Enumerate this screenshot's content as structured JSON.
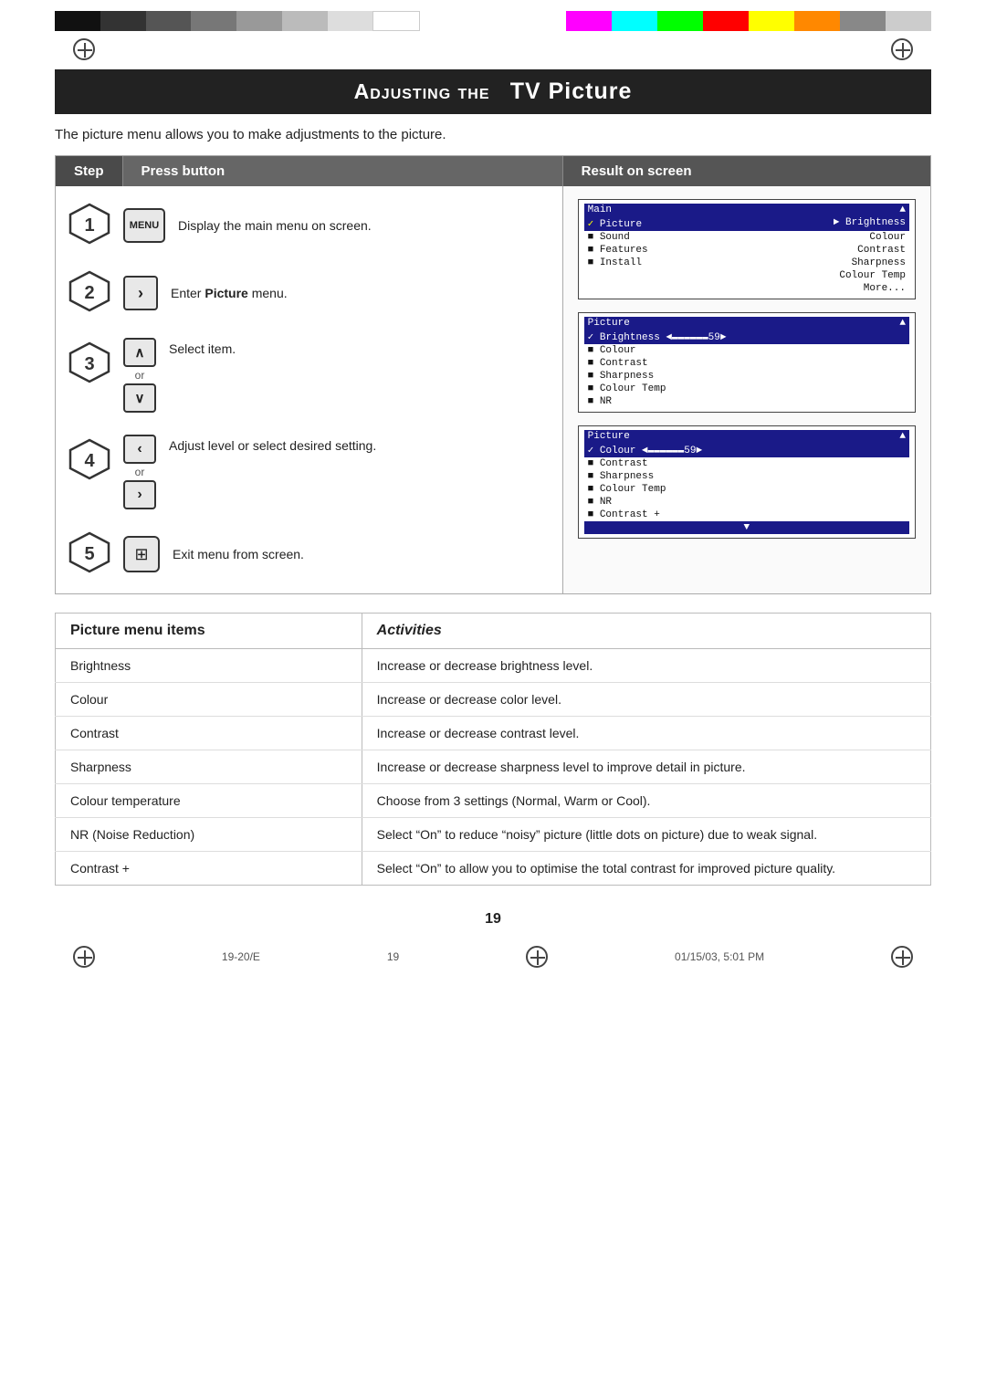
{
  "page": {
    "title": "Adjusting the TV Picture",
    "title_prefix": "Adjusting the",
    "title_main": "TV Picture",
    "intro": "The picture menu allows you to make adjustments to the picture.",
    "page_number": "19",
    "footer_left": "19-20/E",
    "footer_center": "19",
    "footer_right": "01/15/03, 5:01 PM"
  },
  "header": {
    "step_label": "Step",
    "press_label": "Press button",
    "result_label": "Result on screen"
  },
  "steps": [
    {
      "number": "1",
      "button": "MENU",
      "description": "Display the main menu on screen."
    },
    {
      "number": "2",
      "button": ">",
      "description_pre": "Enter ",
      "description_bold": "Picture",
      "description_post": " menu."
    },
    {
      "number": "3",
      "button_up": "∧",
      "button_down": "∨",
      "description": "Select item."
    },
    {
      "number": "4",
      "button_left": "<",
      "button_right": ">",
      "description": "Adjust level or select desired setting."
    },
    {
      "number": "5",
      "button": "⊞",
      "description": "Exit menu from screen."
    }
  ],
  "screens": {
    "screen1": {
      "title": "Main",
      "arrow": "▲",
      "rows": [
        {
          "check": "✓",
          "label": "Picture",
          "right": "► Brightness"
        },
        {
          "bullet": "■",
          "label": "Sound",
          "right": "Colour"
        },
        {
          "bullet": "■",
          "label": "Features",
          "right": "Contrast"
        },
        {
          "bullet": "■",
          "label": "Install",
          "right": "Sharpness"
        },
        {
          "bullet": "",
          "label": "",
          "right": "Colour Temp"
        },
        {
          "bullet": "",
          "label": "",
          "right": "More..."
        }
      ]
    },
    "screen2": {
      "title": "Picture",
      "arrow": "▲",
      "slider_row": "► Brightness ◄▬▬▬▬▬▬▬59►",
      "rows": [
        {
          "bullet": "■",
          "label": "Colour",
          "right": ""
        },
        {
          "bullet": "■",
          "label": "Contrast",
          "right": ""
        },
        {
          "bullet": "■",
          "label": "Sharpness",
          "right": ""
        },
        {
          "bullet": "■",
          "label": "Colour Temp",
          "right": ""
        },
        {
          "bullet": "■",
          "label": "NR",
          "right": ""
        }
      ]
    },
    "screen3": {
      "title": "Picture",
      "arrow": "▲",
      "slider_row": "✓ Colour ◄▬▬▬▬▬▬▬59►",
      "rows": [
        {
          "bullet": "■",
          "label": "Contrast",
          "right": ""
        },
        {
          "bullet": "■",
          "label": "Sharpness",
          "right": ""
        },
        {
          "bullet": "■",
          "label": "Colour Temp",
          "right": ""
        },
        {
          "bullet": "■",
          "label": "NR",
          "right": ""
        },
        {
          "bullet": "■",
          "label": "Contrast +",
          "right": ""
        }
      ],
      "arrow_down": "▼"
    }
  },
  "table": {
    "col1_header": "Picture menu items",
    "col2_header": "Activities",
    "rows": [
      {
        "item": "Brightness",
        "activity": "Increase or decrease brightness level."
      },
      {
        "item": "Colour",
        "activity": "Increase or decrease color level."
      },
      {
        "item": "Contrast",
        "activity": "Increase or decrease contrast level."
      },
      {
        "item": "Sharpness",
        "activity": "Increase or decrease sharpness level to improve detail in picture."
      },
      {
        "item": "Colour temperature",
        "activity": "Choose from 3 settings (Normal, Warm or Cool)."
      },
      {
        "item": "NR (Noise Reduction)",
        "activity": "Select “On” to reduce “noisy” picture (little dots on picture) due to weak signal."
      },
      {
        "item": "Contrast +",
        "activity": "Select “On” to allow you to optimise the total contrast for improved picture quality."
      }
    ]
  },
  "colors": {
    "swatches_left": [
      "#111111",
      "#333333",
      "#555555",
      "#777777",
      "#999999",
      "#bbbbbb",
      "#dddddd",
      "#ffffff"
    ],
    "swatches_right": [
      "#ff00ff",
      "#00ffff",
      "#00ff00",
      "#ff0000",
      "#ffff00",
      "#ff8800",
      "#888888",
      "#cccccc"
    ],
    "title_bg": "#222222",
    "title_fg": "#ffffff",
    "header_bg": "#555555",
    "step_bg": "#4a4a4a",
    "press_bg": "#666666"
  },
  "or_label": "or"
}
